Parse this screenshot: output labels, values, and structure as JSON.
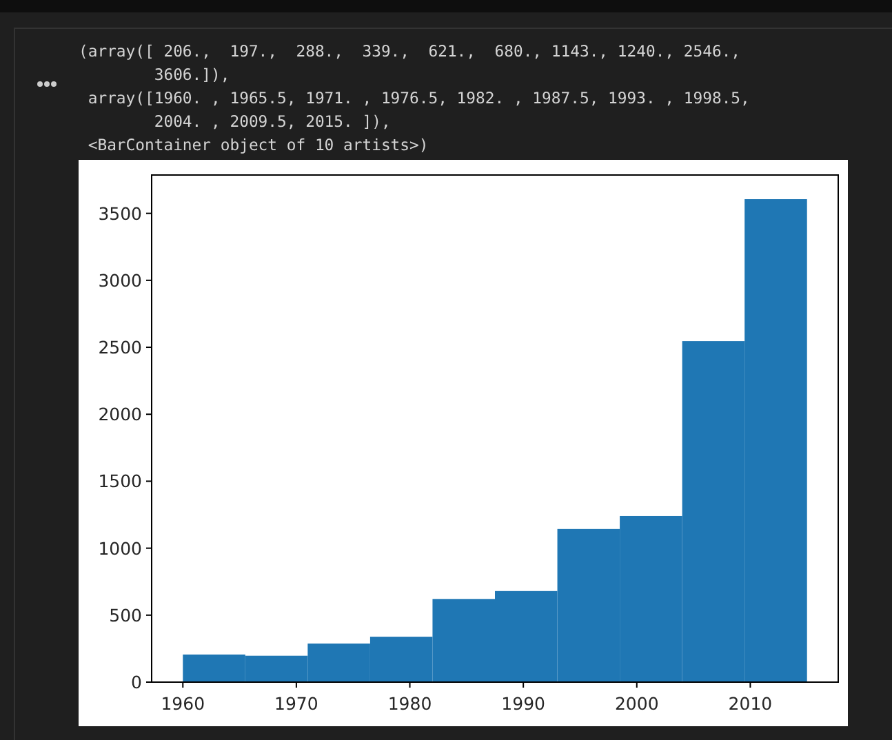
{
  "output_lines": [
    "(array([ 206.,  197.,  288.,  339.,  621.,  680., 1143., 1240., 2546.,",
    "        3606.]),",
    " array([1960. , 1965.5, 1971. , 1976.5, 1982. , 1987.5, 1993. , 1998.5,",
    "        2004. , 2009.5, 2015. ]),",
    " <BarContainer object of 10 artists>)"
  ],
  "figure": {
    "chart_data": {
      "type": "bar",
      "x": [
        1962.75,
        1968.25,
        1973.75,
        1979.25,
        1984.75,
        1990.25,
        1995.75,
        2001.25,
        2006.75,
        2012.25
      ],
      "series": [
        {
          "color": "#1f77b4",
          "values": [
            206,
            197,
            288,
            339,
            621,
            680,
            1143,
            1240,
            2546,
            3606
          ]
        }
      ],
      "xlim": [
        1957.25,
        2017.75
      ],
      "ylim": [
        0,
        3786.3
      ],
      "xticks": [
        1960,
        1970,
        1980,
        1990,
        2000,
        2010
      ],
      "yticks": [
        0,
        500,
        1000,
        1500,
        2000,
        2500,
        3000,
        3500
      ]
    }
  }
}
